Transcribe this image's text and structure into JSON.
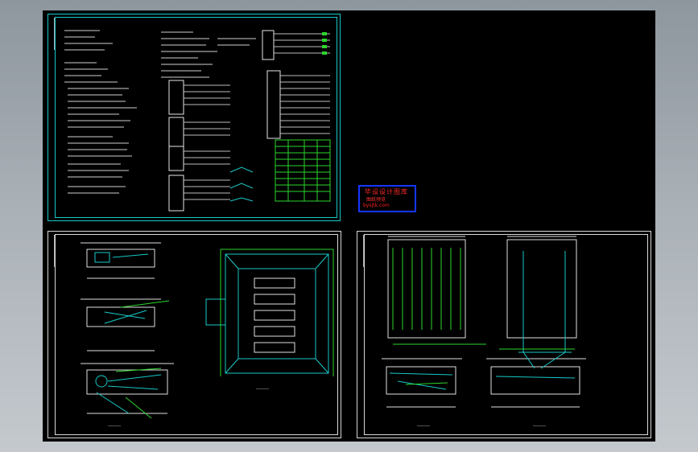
{
  "viewport": {
    "background": "#000000",
    "frame_color": "#d8d8d8",
    "accent": "#18c8c8"
  },
  "stamp": {
    "line1": "毕设设计图库",
    "line2": "图纸预览",
    "line3": "bysjtk.com",
    "color": "#ff2a2a",
    "border": "#1536ff"
  },
  "sheets": {
    "schematic": {
      "name": "system-schematic-sheet"
    },
    "plan_left": {
      "name": "substation-plan-sheet"
    },
    "plan_right": {
      "name": "grounding-plan-sheet"
    }
  },
  "captions": {
    "plan_left_a": "________",
    "plan_left_b": "________",
    "plan_right_a": "________",
    "plan_right_b": "________"
  }
}
